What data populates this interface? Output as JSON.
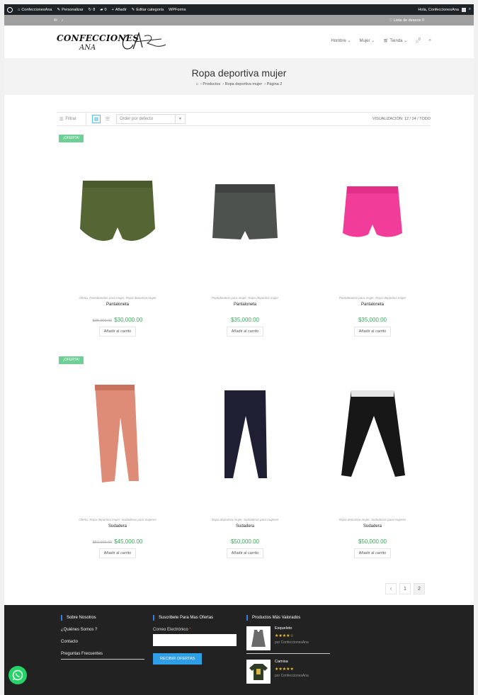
{
  "admin_bar": {
    "site": "ConfeccionesAna",
    "customize": "Personalizar",
    "updates": "8",
    "comments": "0",
    "add_new": "Añadir",
    "edit_category": "Editar categoría",
    "wpforms": "WPForms",
    "greeting": "Hola, ConfeccionesAna"
  },
  "top_bar": {
    "wishlist": "Lista de deseos 0"
  },
  "logo": {
    "line1": "CONFECCIONES",
    "line2": "ANA"
  },
  "nav": {
    "items": [
      "Hombre",
      "Mujer",
      "Tienda"
    ],
    "cart_count": "0"
  },
  "page": {
    "title": "Ropa deportiva mujer",
    "breadcrumb": {
      "home": "⌂",
      "items": [
        "Productos",
        "Ropa deportiva mujer",
        "Página 2"
      ]
    }
  },
  "toolbar": {
    "filter": "Filtrar",
    "order_placeholder": "Order por defecto",
    "visualization": "VISUALIZACIÓN: 12 / 24 / TODO"
  },
  "sale_badge": "¡OFERTA!",
  "products": [
    {
      "cats": "Oferta, Pantalonetas para mujer, Ropa deportiva mujer",
      "name": "Pantaloneta",
      "old_price": "$35,000.00",
      "price": "$30,000.00",
      "button": "Añadir al carrito",
      "color": "#566534"
    },
    {
      "cats": "Pantalonetas para mujer, Ropa deportiva mujer",
      "name": "Pantaloneta",
      "old_price": "",
      "price": "$35,000.00",
      "button": "Añadir al carrito",
      "color": "#4e524f"
    },
    {
      "cats": "Pantalonetas para mujer, Ropa deportiva mujer",
      "name": "Pantaloneta",
      "old_price": "",
      "price": "$35,000.00",
      "button": "Añadir al carrito",
      "color": "#f23c9a"
    },
    {
      "cats": "Oferta, Ropa deportiva mujer, Sudaderas para mujeres",
      "name": "Sudadera",
      "old_price": "$50,000.00",
      "price": "$45,000.00",
      "button": "Añadir al carrito",
      "color": "#de8b78"
    },
    {
      "cats": "Ropa deportiva mujer, Sudaderas para mujeres",
      "name": "Sudadera",
      "old_price": "",
      "price": "$50,000.00",
      "button": "Añadir al carrito",
      "color": "#1e1f33"
    },
    {
      "cats": "Ropa deportiva mujer, Sudaderas para mujeres",
      "name": "Sudadera",
      "old_price": "",
      "price": "$50,000.00",
      "button": "Añadir al carrito",
      "color": "#171717"
    }
  ],
  "pagination": {
    "prev": "‹",
    "pages": [
      "1",
      "2"
    ]
  },
  "footer": {
    "about": {
      "heading": "Sobre Nosotros",
      "links": [
        "¿Quiénes Somos ?",
        "Contacto",
        "Preguntas Frecuentes"
      ]
    },
    "subscribe": {
      "heading": "Suscribete Para Mas Ofertas",
      "email_label": "Correo Electrónico",
      "required": "*",
      "button": "RECIBIR OFERTAS"
    },
    "top_rated": {
      "heading": "Productos Más Valorados",
      "items": [
        {
          "name": "Esqueleto",
          "stars": "★★★★☆",
          "by": "por ConfeccionesAna"
        },
        {
          "name": "Camisa",
          "stars": "★★★★★",
          "by": "por ConfeccionesAna"
        }
      ]
    }
  }
}
